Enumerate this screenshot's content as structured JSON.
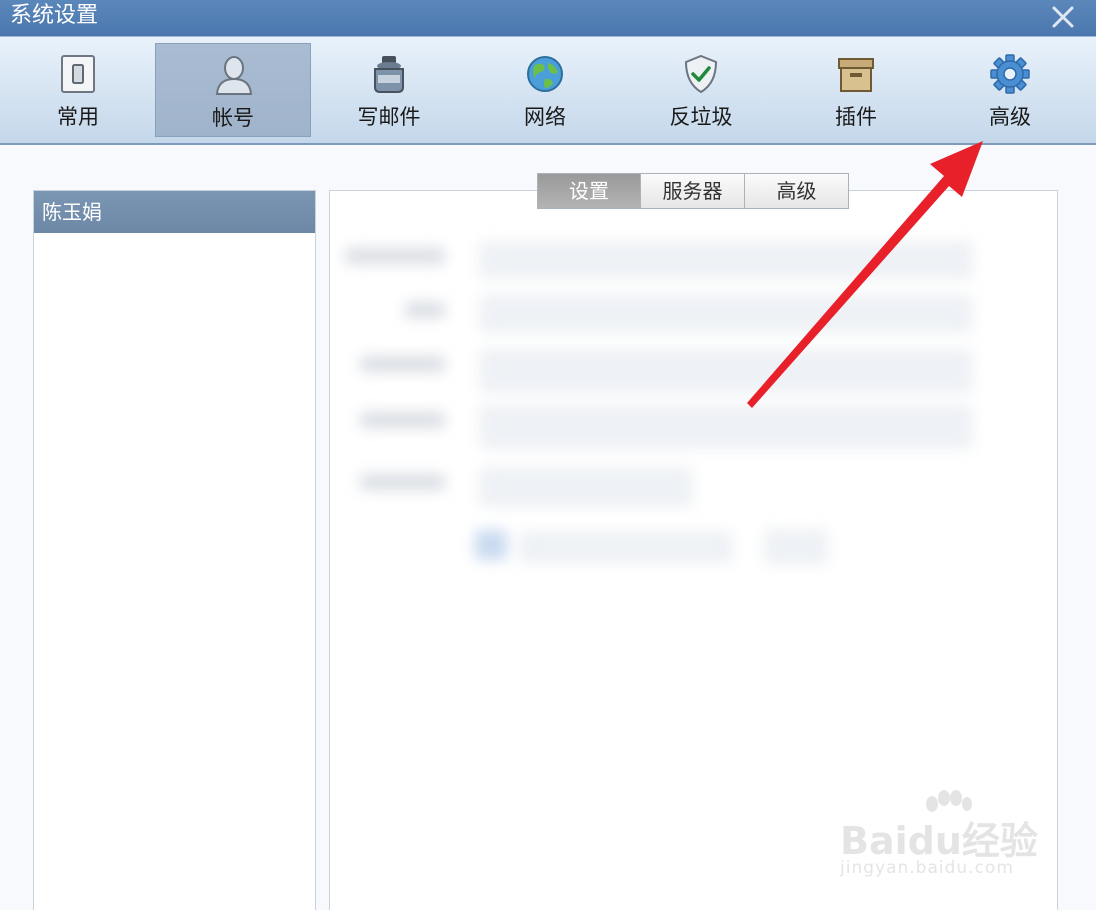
{
  "window": {
    "title": "系统设置"
  },
  "toolbar": {
    "items": [
      {
        "label": "常用",
        "icon": "switch-icon",
        "active": false
      },
      {
        "label": "帐号",
        "icon": "user-icon",
        "active": true
      },
      {
        "label": "写邮件",
        "icon": "ink-bottle-icon",
        "active": false
      },
      {
        "label": "网络",
        "icon": "globe-icon",
        "active": false
      },
      {
        "label": "反垃圾",
        "icon": "shield-check-icon",
        "active": false
      },
      {
        "label": "插件",
        "icon": "box-icon",
        "active": false
      },
      {
        "label": "高级",
        "icon": "gear-icon",
        "active": false
      }
    ]
  },
  "accounts": {
    "items": [
      {
        "name": "陈玉娟",
        "selected": true
      }
    ]
  },
  "tabs": [
    {
      "label": "设置",
      "active": true
    },
    {
      "label": "服务器",
      "active": false
    },
    {
      "label": "高级",
      "active": false
    }
  ],
  "watermark": {
    "brand": "Baidu经验",
    "url": "jingyan.baidu.com"
  },
  "colors": {
    "titlebar": "#4a77ad",
    "toolbar": "#c4d7ea",
    "selected_account": "#6d88a6",
    "arrow": "#e8202a"
  }
}
